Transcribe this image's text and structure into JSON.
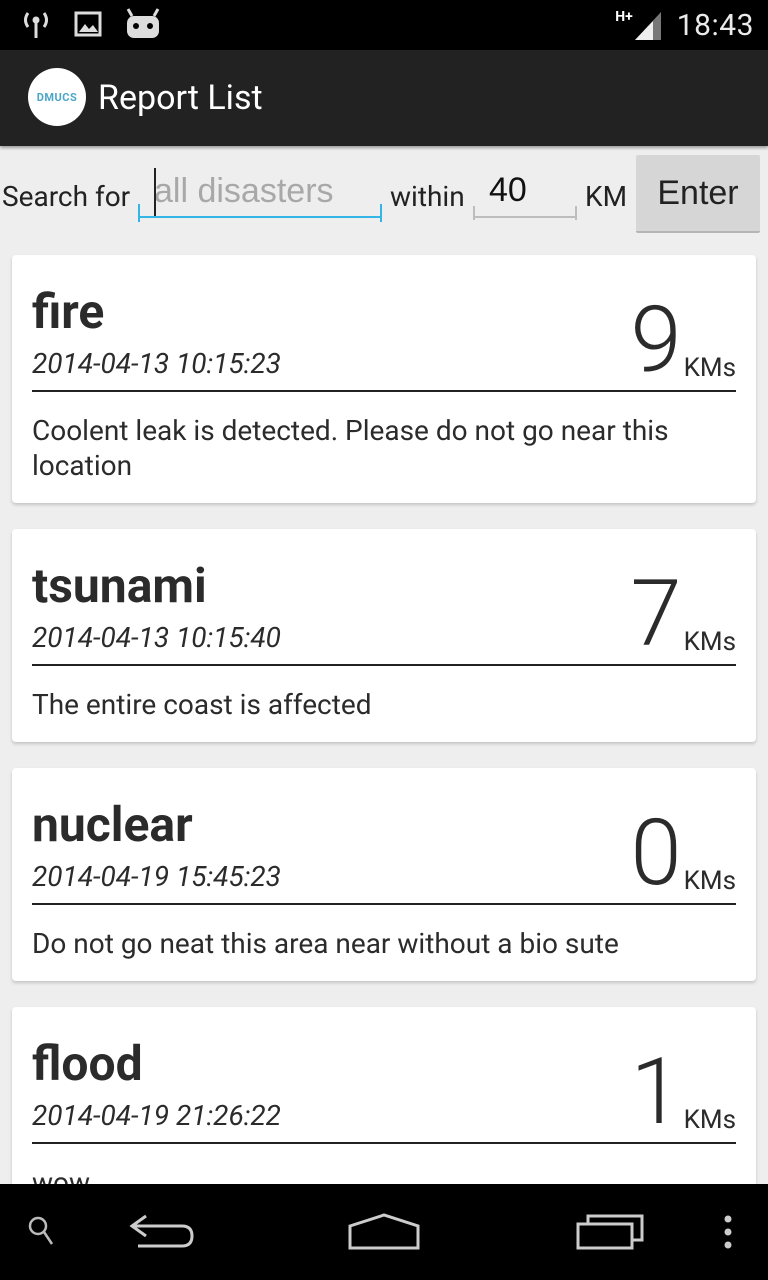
{
  "status_bar": {
    "time": "18:43",
    "network_label": "H+",
    "icons": [
      "wifi-icon",
      "image-icon",
      "android-icon",
      "signal-icon"
    ]
  },
  "app_bar": {
    "logo_text": "DMUCS",
    "title": "Report List"
  },
  "search": {
    "search_for_label": "Search for",
    "query_placeholder": "all disasters",
    "query_value": "",
    "within_label": "within",
    "distance_value": "40",
    "unit_label": "KM",
    "enter_label": "Enter"
  },
  "reports": [
    {
      "title": "fire",
      "datetime": "2014-04-13 10:15:23",
      "distance": "9",
      "unit": "KMs",
      "description": "Coolent leak is detected. Please do not go near this location"
    },
    {
      "title": "tsunami",
      "datetime": "2014-04-13 10:15:40",
      "distance": "7",
      "unit": "KMs",
      "description": "The entire coast is affected"
    },
    {
      "title": "nuclear",
      "datetime": "2014-04-19 15:45:23",
      "distance": "0",
      "unit": "KMs",
      "description": "Do not go neat this area near without a bio sute"
    },
    {
      "title": "flood",
      "datetime": "2014-04-19 21:26:22",
      "distance": "1",
      "unit": "KMs",
      "description": "wow"
    }
  ],
  "nav_bar": {
    "icons": [
      "search-icon",
      "back-icon",
      "home-icon",
      "recent-apps-icon",
      "overflow-menu-icon"
    ]
  }
}
